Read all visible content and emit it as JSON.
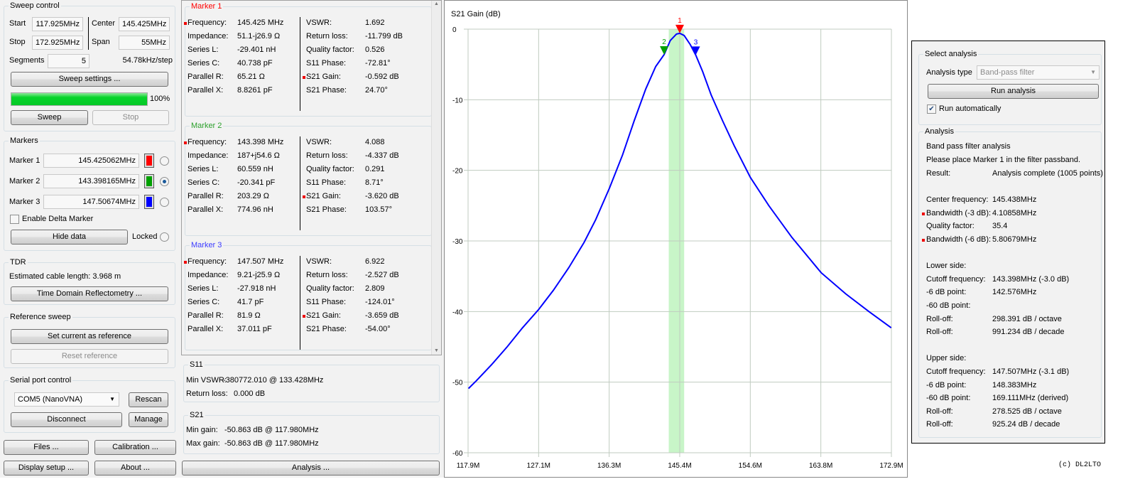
{
  "sweep_control": {
    "title": "Sweep control",
    "start_label": "Start",
    "start_value": "117.925MHz",
    "stop_label": "Stop",
    "stop_value": "172.925MHz",
    "center_label": "Center",
    "center_value": "145.425MHz",
    "span_label": "Span",
    "span_value": "55MHz",
    "segments_label": "Segments",
    "segments_value": "5",
    "step_text": "54.78kHz/step",
    "settings_button": "Sweep settings ...",
    "progress_percent": 100,
    "progress_text": "100%",
    "sweep_button": "Sweep",
    "stop_button": "Stop"
  },
  "markers": {
    "title": "Markers",
    "items": [
      {
        "label": "Marker 1",
        "value": "145.425062MHz",
        "color": "#ff0000",
        "selected": false
      },
      {
        "label": "Marker 2",
        "value": "143.398165MHz",
        "color": "#00a000",
        "selected": true
      },
      {
        "label": "Marker 3",
        "value": "147.50674MHz",
        "color": "#0000ff",
        "selected": false
      }
    ],
    "delta_label": "Enable Delta Marker",
    "hide_button": "Hide data",
    "locked_label": "Locked"
  },
  "tdr": {
    "title": "TDR",
    "cable_text": "Estimated cable length: 3.968 m",
    "button": "Time Domain Reflectometry ..."
  },
  "reference": {
    "title": "Reference sweep",
    "set_button": "Set current as reference",
    "reset_button": "Reset reference"
  },
  "serial": {
    "title": "Serial port control",
    "port": "COM5 (NanoVNA)",
    "rescan_button": "Rescan",
    "disconnect_button": "Disconnect",
    "manage_button": "Manage"
  },
  "bottom_buttons": {
    "files": "Files ...",
    "calibration": "Calibration ...",
    "display": "Display setup ...",
    "about": "About ...",
    "analysis": "Analysis ..."
  },
  "marker_data": [
    {
      "title": "Marker 1",
      "color": "#ff0000",
      "left": [
        [
          "Frequency:",
          "145.425 MHz"
        ],
        [
          "Impedance:",
          "51.1-j26.9 Ω"
        ],
        [
          "Series L:",
          "-29.401 nH"
        ],
        [
          "Series C:",
          "40.738 pF"
        ],
        [
          "Parallel R:",
          "65.21 Ω"
        ],
        [
          "Parallel X:",
          "8.8261 pF"
        ]
      ],
      "right": [
        [
          "VSWR:",
          "1.692"
        ],
        [
          "Return loss:",
          "-11.799 dB"
        ],
        [
          "Quality factor:",
          "0.526"
        ],
        [
          "S11 Phase:",
          "-72.81°"
        ],
        [
          "S21 Gain:",
          "-0.592 dB"
        ],
        [
          "S21 Phase:",
          "24.70°"
        ]
      ]
    },
    {
      "title": "Marker 2",
      "color": "#2ca02c",
      "left": [
        [
          "Frequency:",
          "143.398 MHz"
        ],
        [
          "Impedance:",
          "187+j54.6 Ω"
        ],
        [
          "Series L:",
          "60.559 nH"
        ],
        [
          "Series C:",
          "-20.341 pF"
        ],
        [
          "Parallel R:",
          "203.29 Ω"
        ],
        [
          "Parallel X:",
          "774.96 nH"
        ]
      ],
      "right": [
        [
          "VSWR:",
          "4.088"
        ],
        [
          "Return loss:",
          "-4.337 dB"
        ],
        [
          "Quality factor:",
          "0.291"
        ],
        [
          "S11 Phase:",
          "8.71°"
        ],
        [
          "S21 Gain:",
          "-3.620 dB"
        ],
        [
          "S21 Phase:",
          "103.57°"
        ]
      ]
    },
    {
      "title": "Marker 3",
      "color": "#3c3cff",
      "left": [
        [
          "Frequency:",
          "147.507 MHz"
        ],
        [
          "Impedance:",
          "9.21-j25.9 Ω"
        ],
        [
          "Series L:",
          "-27.918 nH"
        ],
        [
          "Series C:",
          "41.7 pF"
        ],
        [
          "Parallel R:",
          "81.9 Ω"
        ],
        [
          "Parallel X:",
          "37.011 pF"
        ]
      ],
      "right": [
        [
          "VSWR:",
          "6.922"
        ],
        [
          "Return loss:",
          "-2.527 dB"
        ],
        [
          "Quality factor:",
          "2.809"
        ],
        [
          "S11 Phase:",
          "-124.01°"
        ],
        [
          "S21 Gain:",
          "-3.659 dB"
        ],
        [
          "S21 Phase:",
          "-54.00°"
        ]
      ]
    }
  ],
  "s11": {
    "title": "S11",
    "min_vswr_label": "Min VSWR:",
    "min_vswr_value": "-380772.010 @ 133.428MHz",
    "return_loss_label": "Return loss:",
    "return_loss_value": "0.000 dB"
  },
  "s21": {
    "title": "S21",
    "min_gain_label": "Min gain:",
    "min_gain_value": "-50.863 dB @ 117.980MHz",
    "max_gain_label": "Max gain:",
    "max_gain_value": "-50.863 dB @ 117.980MHz"
  },
  "chart_data": {
    "type": "line",
    "title": "S21 Gain (dB)",
    "xlabel": "",
    "ylabel": "",
    "xlim": [
      117.925,
      172.925
    ],
    "ylim": [
      -60,
      0
    ],
    "x_ticks": [
      "117.9M",
      "127.1M",
      "136.3M",
      "145.4M",
      "154.6M",
      "163.8M",
      "172.9M"
    ],
    "x_tick_values": [
      117.925,
      127.092,
      136.258,
      145.425,
      154.592,
      163.758,
      172.925
    ],
    "y_ticks": [
      0,
      -10,
      -20,
      -30,
      -40,
      -50,
      -60
    ],
    "grid": true,
    "highlight_band": [
      144.0,
      146.0
    ],
    "series": [
      {
        "color": "#0000ff",
        "x": [
          117.98,
          119,
          121,
          123,
          125,
          127.1,
          129,
          131,
          133,
          134.5,
          136.3,
          138,
          139.5,
          141,
          142.3,
          143.4,
          144.2,
          145.0,
          145.43,
          146.0,
          146.8,
          147.5,
          148.4,
          149.5,
          151,
          152.5,
          154.6,
          157,
          160,
          163.8,
          167,
          170,
          172.9
        ],
        "y": [
          -50.9,
          -49.8,
          -47.5,
          -45,
          -42.3,
          -39.7,
          -37,
          -33.8,
          -30.2,
          -27,
          -22.5,
          -17.8,
          -13,
          -8.5,
          -5.3,
          -3.6,
          -1.6,
          -0.7,
          -0.59,
          -0.9,
          -2.2,
          -3.66,
          -6,
          -9.3,
          -13,
          -16.5,
          -21,
          -25,
          -29.5,
          -34.5,
          -37.5,
          -40,
          -42.3
        ]
      }
    ],
    "markers": [
      {
        "label": "1",
        "x": 145.425,
        "y": -0.592,
        "color": "#ff0000"
      },
      {
        "label": "2",
        "x": 143.398,
        "y": -3.62,
        "color": "#00a000"
      },
      {
        "label": "3",
        "x": 147.507,
        "y": -3.659,
        "color": "#0000ff"
      }
    ]
  },
  "analysis": {
    "select_title": "Select analysis",
    "type_label": "Analysis type",
    "type_value": "Band-pass filter",
    "run_button": "Run analysis",
    "auto_label": "Run automatically",
    "auto_checked": true,
    "results_title": "Analysis",
    "heading": "Band pass filter analysis",
    "hint": "Please place Marker 1 in the filter passband.",
    "rows": [
      {
        "label": "Result:",
        "value": "Analysis complete (1005 points)",
        "mark": false
      },
      {
        "label": "",
        "value": "",
        "mark": false
      },
      {
        "label": "Center frequency:",
        "value": "145.438MHz",
        "mark": false
      },
      {
        "label": "Bandwidth (-3 dB):",
        "value": "4.10858MHz",
        "mark": true
      },
      {
        "label": "Quality factor:",
        "value": "35.4",
        "mark": false
      },
      {
        "label": "Bandwidth (-6 dB):",
        "value": "5.80679MHz",
        "mark": true
      },
      {
        "label": "",
        "value": "",
        "mark": false
      },
      {
        "label": "Lower side:",
        "value": "",
        "mark": false
      },
      {
        "label": "Cutoff frequency:",
        "value": "143.398MHz (-3.0 dB)",
        "mark": false
      },
      {
        "label": "-6 dB point:",
        "value": "142.576MHz",
        "mark": false
      },
      {
        "label": "-60 dB point:",
        "value": "",
        "mark": false
      },
      {
        "label": "Roll-off:",
        "value": "298.391 dB / octave",
        "mark": false
      },
      {
        "label": "Roll-off:",
        "value": "991.234 dB / decade",
        "mark": false
      },
      {
        "label": "",
        "value": "",
        "mark": false
      },
      {
        "label": "Upper side:",
        "value": "",
        "mark": false
      },
      {
        "label": "Cutoff frequency:",
        "value": "147.507MHz (-3.1 dB)",
        "mark": false
      },
      {
        "label": "-6 dB point:",
        "value": "148.383MHz",
        "mark": false
      },
      {
        "label": "-60 dB point:",
        "value": "169.111MHz (derived)",
        "mark": false
      },
      {
        "label": "Roll-off:",
        "value": "278.525 dB / octave",
        "mark": false
      },
      {
        "label": "Roll-off:",
        "value": "925.24 dB / decade",
        "mark": false
      }
    ]
  },
  "copyright": "(c) DL2LTO"
}
